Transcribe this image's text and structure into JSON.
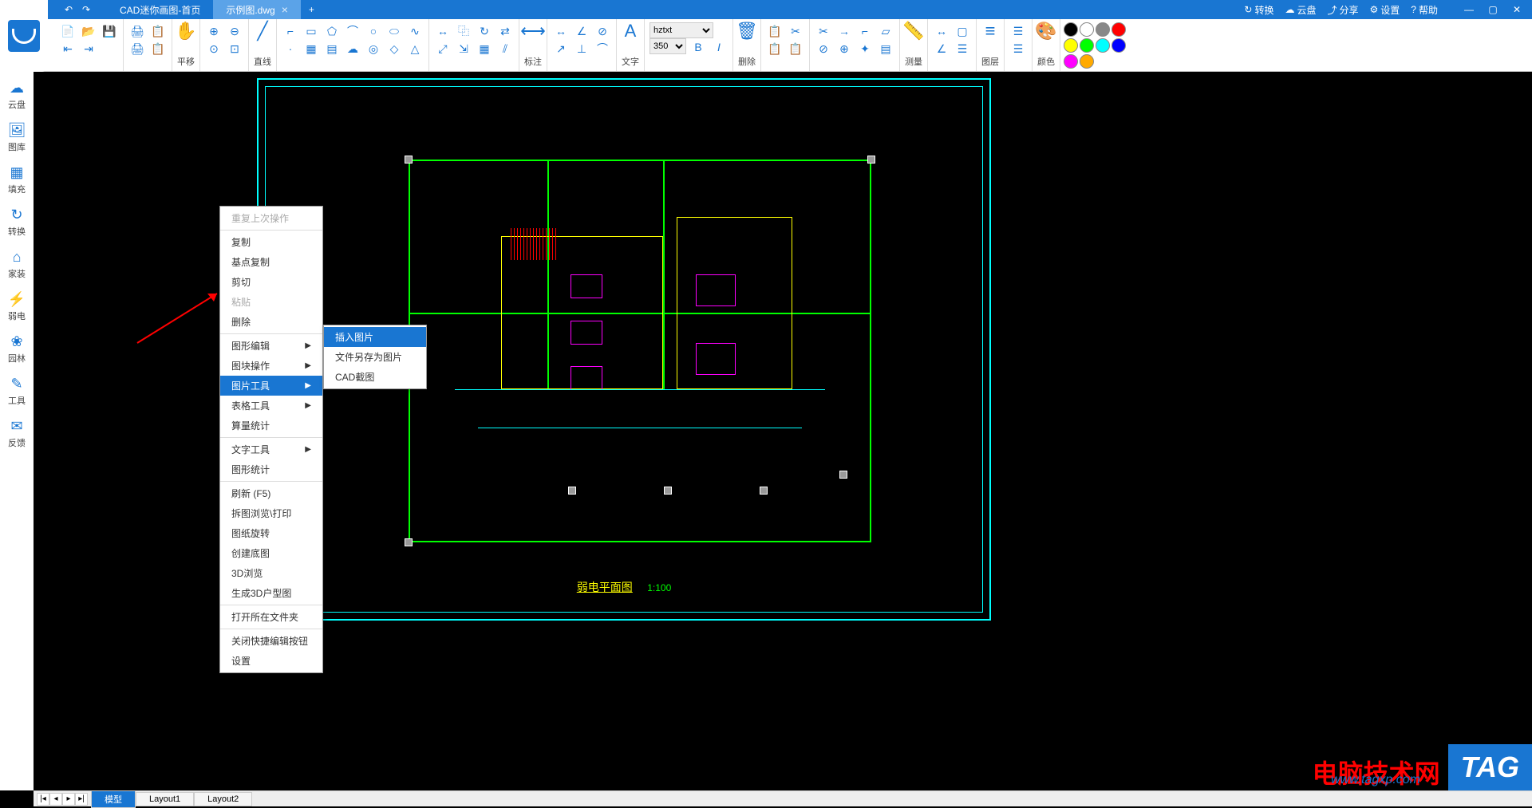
{
  "tabs": [
    {
      "label": "CAD迷你画图-首页",
      "active": false
    },
    {
      "label": "示例图.dwg",
      "active": true
    }
  ],
  "titlebar_right": {
    "convert": "转换",
    "cloud": "云盘",
    "share": "分享",
    "settings": "设置",
    "help": "帮助"
  },
  "ribbon": {
    "pan": "平移",
    "line": "直线",
    "dim": "标注",
    "text": "文字",
    "del": "删除",
    "measure": "测量",
    "layer": "图层",
    "color": "颜色",
    "font": "hztxt",
    "size": "350",
    "bold": "B",
    "italic": "I"
  },
  "sidebar": [
    {
      "icon": "☁",
      "label": "云盘"
    },
    {
      "icon": "🖼",
      "label": "图库"
    },
    {
      "icon": "▦",
      "label": "填充"
    },
    {
      "icon": "↻",
      "label": "转换"
    },
    {
      "icon": "⌂",
      "label": "家装"
    },
    {
      "icon": "⚡",
      "label": "弱电"
    },
    {
      "icon": "❀",
      "label": "园林"
    },
    {
      "icon": "✎",
      "label": "工具"
    },
    {
      "icon": "✉",
      "label": "反馈"
    }
  ],
  "context_menu": {
    "items": [
      {
        "label": "重复上次操作",
        "dis": true
      },
      {
        "sep": true
      },
      {
        "label": "复制"
      },
      {
        "label": "基点复制"
      },
      {
        "label": "剪切"
      },
      {
        "label": "粘贴",
        "dis": true
      },
      {
        "label": "删除"
      },
      {
        "sep": true
      },
      {
        "label": "图形编辑",
        "sub": true
      },
      {
        "label": "图块操作",
        "sub": true
      },
      {
        "label": "图片工具",
        "sub": true,
        "hl": true
      },
      {
        "label": "表格工具",
        "sub": true
      },
      {
        "label": "算量统计"
      },
      {
        "sep": true
      },
      {
        "label": "文字工具",
        "sub": true
      },
      {
        "label": "图形统计"
      },
      {
        "sep": true
      },
      {
        "label": "刷新 (F5)"
      },
      {
        "label": "拆图浏览\\打印"
      },
      {
        "label": "图纸旋转"
      },
      {
        "label": "创建底图"
      },
      {
        "label": "3D浏览"
      },
      {
        "label": "生成3D户型图"
      },
      {
        "sep": true
      },
      {
        "label": "打开所在文件夹"
      },
      {
        "sep": true
      },
      {
        "label": "关闭快捷编辑按钮"
      },
      {
        "label": "设置"
      }
    ]
  },
  "submenu": {
    "items": [
      {
        "label": "插入图片",
        "hl": true
      },
      {
        "label": "文件另存为图片"
      },
      {
        "label": "CAD截图"
      }
    ]
  },
  "drawing": {
    "title": "弱电平面图",
    "scale": "1:100"
  },
  "status": {
    "tabs": [
      "模型",
      "Layout1",
      "Layout2"
    ]
  },
  "watermark": {
    "text": "电脑技术网",
    "url": "www.tagxp.com",
    "tag": "TAG"
  },
  "colors": [
    "#000",
    "#fff",
    "#888",
    "#f00",
    "#ff0",
    "#0f0",
    "#0ff",
    "#00f",
    "#f0f",
    "#fa0"
  ]
}
